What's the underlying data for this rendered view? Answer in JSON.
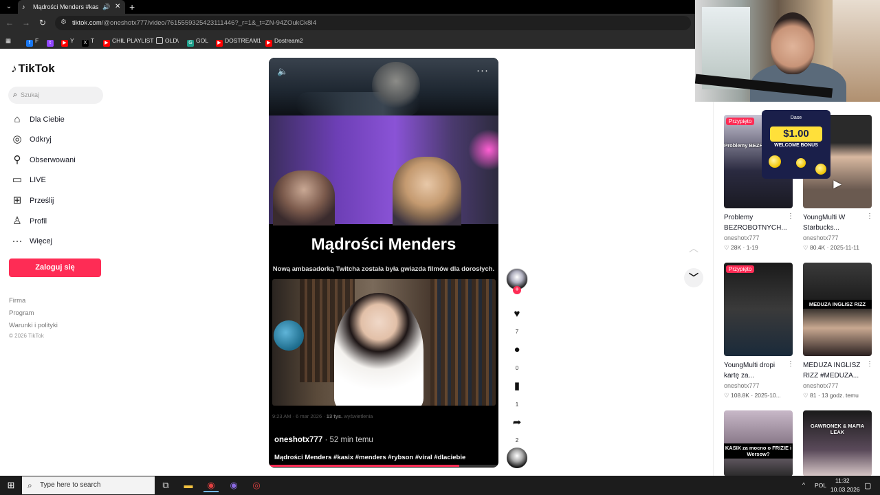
{
  "browser": {
    "tab_title": "Mądrości Menders #kasix #",
    "url_host": "tiktok.com",
    "url_path": "/@oneshotx777/video/7615559325423111446?_r=1&_t=ZN-94ZOukCk8I4",
    "bookmarks": [
      "F",
      "Y",
      "T",
      "CHIL PLAYLIST",
      "OLD\\",
      "GOL",
      "DOSTREAM1",
      "Dostream2"
    ]
  },
  "sidebar": {
    "logo": "TikTok",
    "search_placeholder": "Szukaj",
    "items": [
      {
        "label": "Dla Ciebie",
        "icon": "home-icon"
      },
      {
        "label": "Odkryj",
        "icon": "compass-icon"
      },
      {
        "label": "Obserwowani",
        "icon": "user-follow-icon"
      },
      {
        "label": "LIVE",
        "icon": "live-icon"
      },
      {
        "label": "Prześlij",
        "icon": "upload-icon"
      },
      {
        "label": "Profil",
        "icon": "profile-icon"
      },
      {
        "label": "Więcej",
        "icon": "more-icon"
      }
    ],
    "login": "Zaloguj się",
    "footer_links": [
      "Firma",
      "Program",
      "Warunki i polityki"
    ],
    "copyright": "© 2026 TikTok"
  },
  "video": {
    "title_overlay": "Mądrości Menders",
    "subtitle_overlay": "Nową ambasadorką Twitcha została była gwiazda filmów dla dorosłych.",
    "meta_time": "9:23 AM · 6 mar 2026 · ",
    "meta_views": "13 tys.",
    "meta_views_label": " wyświetlenia",
    "author": "oneshotx777",
    "posted": " · 52 min temu",
    "caption": "Mądrości Menders #kasix #menders #rybson #viral #dlaciebie",
    "progress": 0.83
  },
  "actions": {
    "likes": "7",
    "comments": "0",
    "saves": "1",
    "shares": "2"
  },
  "related": [
    {
      "title": "Problemy BEZROBOTNYCH...",
      "author": "oneshotx777",
      "likes": "28K",
      "date": "1-19",
      "pinned": "Przypięto",
      "overlay": "Problemy BEZROBOTNYCH"
    },
    {
      "title": "YoungMulti W Starbucks...",
      "author": "oneshotx777",
      "likes": "80.4K",
      "date": "2025-11-11",
      "pinned": "",
      "overlay": ""
    },
    {
      "title": "YoungMulti dropi kartę za...",
      "author": "oneshotx777",
      "likes": "108.8K",
      "date": "2025-10...",
      "pinned": "Przypięto",
      "overlay": ""
    },
    {
      "title": "MEDUZA INGLISZ RIZZ #MEDUZA...",
      "author": "oneshotx777",
      "likes": "81",
      "date": "13 godz. temu",
      "pinned": "",
      "overlay": "MEDUZA INGLISZ RIZZ"
    },
    {
      "title": "",
      "author": "",
      "likes": "",
      "date": "",
      "pinned": "",
      "overlay": "KASIX za mocno o FRIZIE i Wersow?"
    },
    {
      "title": "",
      "author": "",
      "likes": "",
      "date": "",
      "pinned": "",
      "overlay": "GAWRONEK & MAFIA LEAK"
    }
  ],
  "ad": {
    "brand": "Dase",
    "amount": "$1.00",
    "bonus": "WELCOME BONUS"
  },
  "taskbar": {
    "search_placeholder": "Type here to search",
    "language": "POL",
    "time": "11:32",
    "date": "10.03.2026"
  },
  "colors": {
    "accent": "#fe2c55",
    "browser_dark": "#2b2b2b"
  }
}
